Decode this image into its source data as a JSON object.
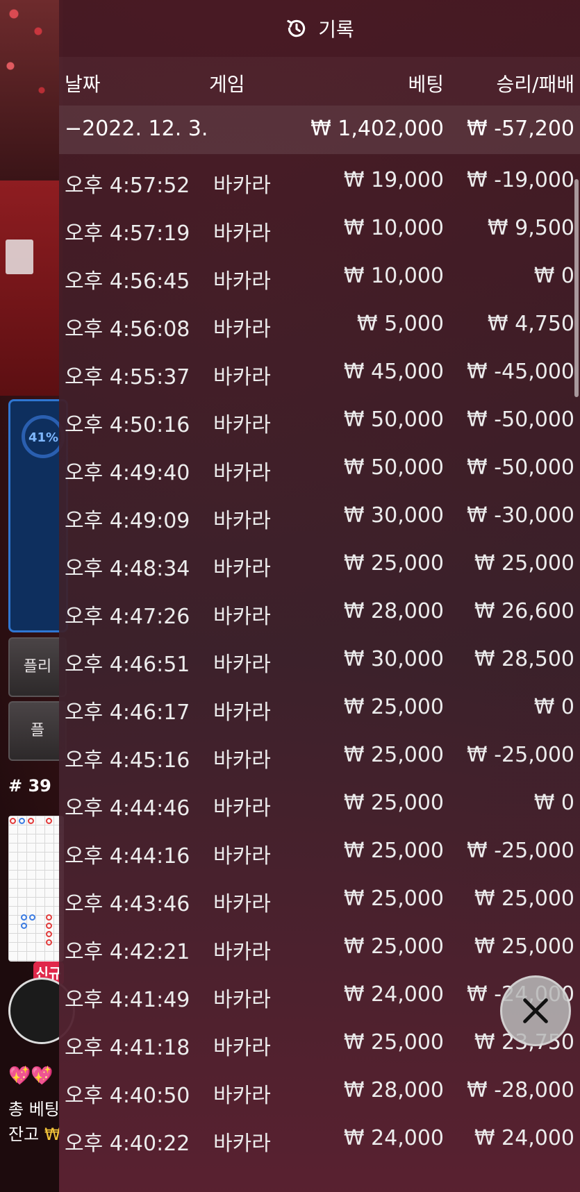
{
  "panel": {
    "title": "기록",
    "title_icon": "history-icon"
  },
  "columns": {
    "date": "날짜",
    "game": "게임",
    "bet": "베팅",
    "winloss": "승리/패배"
  },
  "day_summary": {
    "date": "−2022. 12. 3.",
    "bet": "₩ 1,402,000",
    "winloss": "₩ -57,200"
  },
  "rows": [
    {
      "time": "오후 4:57:52",
      "game": "바카라",
      "bet": "₩ 19,000",
      "winloss": "₩ -19,000"
    },
    {
      "time": "오후 4:57:19",
      "game": "바카라",
      "bet": "₩ 10,000",
      "winloss": "₩ 9,500"
    },
    {
      "time": "오후 4:56:45",
      "game": "바카라",
      "bet": "₩ 10,000",
      "winloss": "₩ 0"
    },
    {
      "time": "오후 4:56:08",
      "game": "바카라",
      "bet": "₩ 5,000",
      "winloss": "₩ 4,750"
    },
    {
      "time": "오후 4:55:37",
      "game": "바카라",
      "bet": "₩ 45,000",
      "winloss": "₩ -45,000"
    },
    {
      "time": "오후 4:50:16",
      "game": "바카라",
      "bet": "₩ 50,000",
      "winloss": "₩ -50,000"
    },
    {
      "time": "오후 4:49:40",
      "game": "바카라",
      "bet": "₩ 50,000",
      "winloss": "₩ -50,000"
    },
    {
      "time": "오후 4:49:09",
      "game": "바카라",
      "bet": "₩ 30,000",
      "winloss": "₩ -30,000"
    },
    {
      "time": "오후 4:48:34",
      "game": "바카라",
      "bet": "₩ 25,000",
      "winloss": "₩ 25,000"
    },
    {
      "time": "오후 4:47:26",
      "game": "바카라",
      "bet": "₩ 28,000",
      "winloss": "₩ 26,600"
    },
    {
      "time": "오후 4:46:51",
      "game": "바카라",
      "bet": "₩ 30,000",
      "winloss": "₩ 28,500"
    },
    {
      "time": "오후 4:46:17",
      "game": "바카라",
      "bet": "₩ 25,000",
      "winloss": "₩ 0"
    },
    {
      "time": "오후 4:45:16",
      "game": "바카라",
      "bet": "₩ 25,000",
      "winloss": "₩ -25,000"
    },
    {
      "time": "오후 4:44:46",
      "game": "바카라",
      "bet": "₩ 25,000",
      "winloss": "₩ 0"
    },
    {
      "time": "오후 4:44:16",
      "game": "바카라",
      "bet": "₩ 25,000",
      "winloss": "₩ -25,000"
    },
    {
      "time": "오후 4:43:46",
      "game": "바카라",
      "bet": "₩ 25,000",
      "winloss": "₩ 25,000"
    },
    {
      "time": "오후 4:42:21",
      "game": "바카라",
      "bet": "₩ 25,000",
      "winloss": "₩ 25,000"
    },
    {
      "time": "오후 4:41:49",
      "game": "바카라",
      "bet": "₩ 24,000",
      "winloss": "₩ -24,000"
    },
    {
      "time": "오후 4:41:18",
      "game": "바카라",
      "bet": "₩ 25,000",
      "winloss": "₩ 23,750"
    },
    {
      "time": "오후 4:40:50",
      "game": "바카라",
      "bet": "₩ 28,000",
      "winloss": "₩ -28,000"
    },
    {
      "time": "오후 4:40:22",
      "game": "바카라",
      "bet": "₩ 24,000",
      "winloss": "₩ 24,000"
    }
  ],
  "background_game": {
    "progress_label": "41%",
    "progress_fraction": 0.41,
    "player_button_1": "플",
    "player_button_2": "플리",
    "player_button_3": "플",
    "round_number": "# 39",
    "new_badge": "신규",
    "hearts": "💖💖",
    "total_bet_label": "총 베팅",
    "balance_label": "잔고",
    "balance_currency": "₩"
  },
  "colors": {
    "panel_top": "#481a24",
    "panel_bottom": "#5c2232",
    "progress_blue": "#2f76d2",
    "badge_red": "#e0284a",
    "won_gold": "#f3c43a"
  },
  "close_icon": "close-icon"
}
